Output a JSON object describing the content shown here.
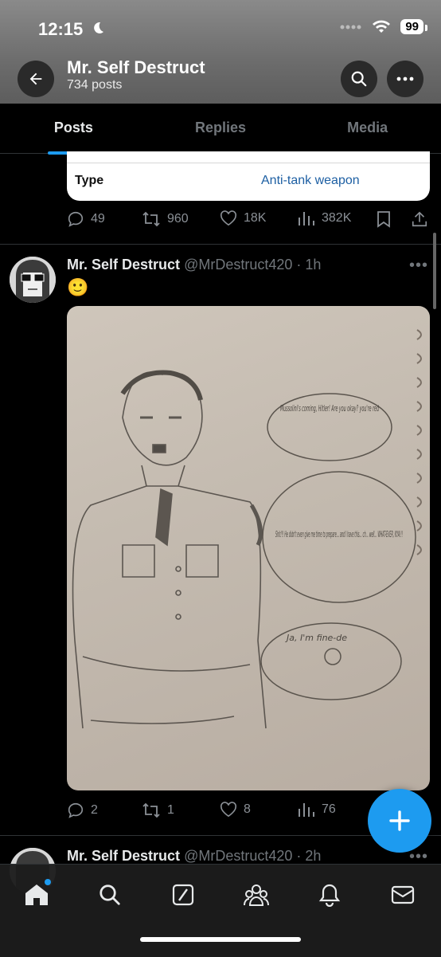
{
  "status_bar": {
    "time": "12:15",
    "battery": "99"
  },
  "header": {
    "title": "Mr. Self Destruct",
    "subtitle": "734 posts"
  },
  "tabs": [
    {
      "label": "Posts"
    },
    {
      "label": "Replies"
    },
    {
      "label": "Media"
    }
  ],
  "card": {
    "label": "Type",
    "value": "Anti-tank weapon"
  },
  "post1_actions": {
    "replies": "49",
    "reposts": "960",
    "likes": "18K",
    "views": "382K"
  },
  "post2": {
    "name": "Mr. Self Destruct",
    "meta": "@MrDestruct420 · 1h",
    "text": "🙂",
    "image_alt_text": {
      "bubble1": "Mussolini's coming, Hitler! Are you okay? you're red",
      "bubble2": "Shit!!! He didn't even give me time to prepare... and I have this... ch... well... WHAT-EVER, KYA!!!",
      "bubble3": "Ja, I'm fine-de"
    },
    "actions": {
      "replies": "2",
      "reposts": "1",
      "likes": "8",
      "views": "76"
    }
  },
  "post3": {
    "name": "Mr. Self Destruct",
    "meta": "@MrDestruct420 · 2h"
  },
  "colors": {
    "accent": "#1d9bf0",
    "background": "#000000",
    "muted": "#71767b"
  },
  "icons": [
    "back-arrow-icon",
    "search-icon",
    "more-icon",
    "reply-icon",
    "repost-icon",
    "like-icon",
    "views-icon",
    "bookmark-icon",
    "share-icon",
    "plus-icon",
    "home-icon",
    "explore-icon",
    "grok-icon",
    "communities-icon",
    "notifications-icon",
    "messages-icon"
  ]
}
